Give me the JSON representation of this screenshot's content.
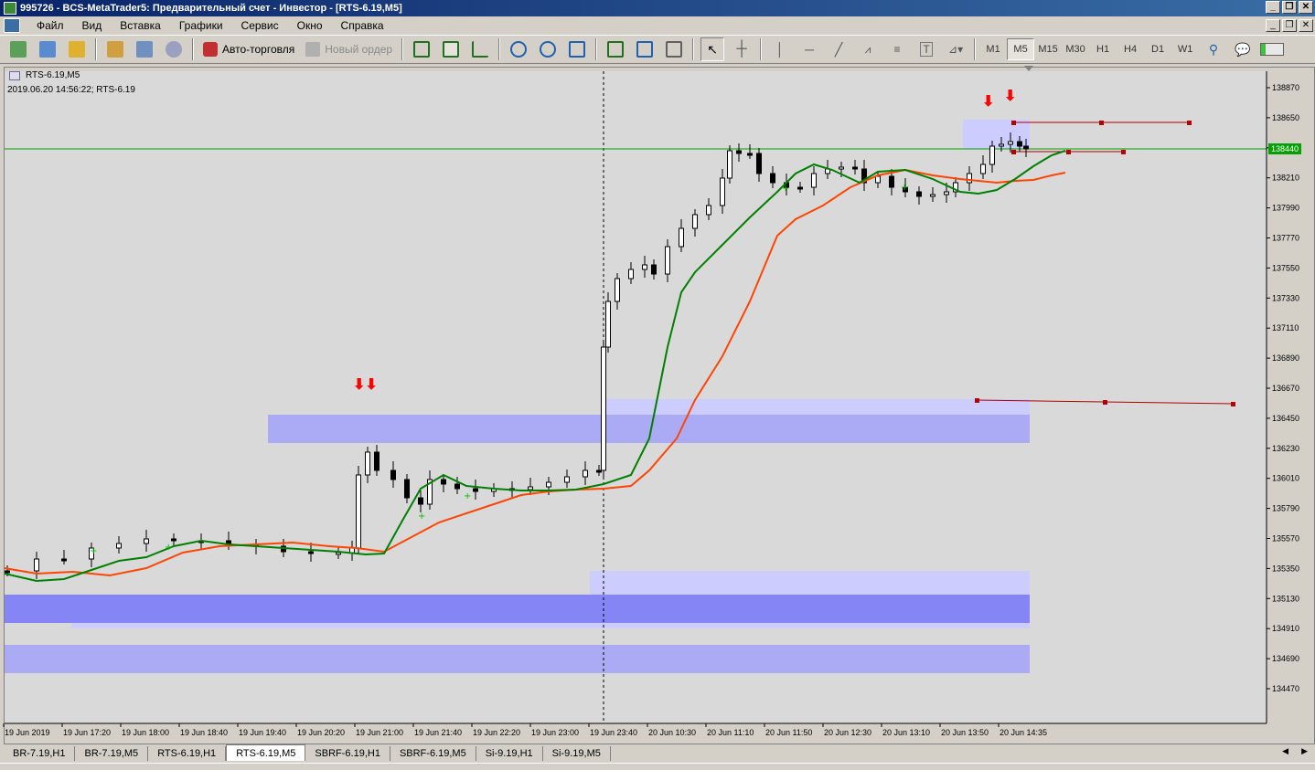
{
  "window": {
    "title": "995726 - BCS-MetaTrader5: Предварительный счет - Инвестор - [RTS-6.19,M5]"
  },
  "menu": {
    "items": [
      "Файл",
      "Вид",
      "Вставка",
      "Графики",
      "Сервис",
      "Окно",
      "Справка"
    ]
  },
  "toolbar": {
    "auto_trading_label": "Авто-торговля",
    "new_order_label": "Новый ордер",
    "timeframes": [
      "M1",
      "M5",
      "M15",
      "M30",
      "H1",
      "H4",
      "D1",
      "W1"
    ],
    "active_timeframe": "M5"
  },
  "chart": {
    "symbol_label": "RTS-6.19,M5",
    "info_line": "2019.06.20 14:56:22; RTS-6.19",
    "current_price": "138440",
    "price_ticks": [
      "138870",
      "138650",
      "138430",
      "138210",
      "137990",
      "137770",
      "137550",
      "137330",
      "137110",
      "136890",
      "136670",
      "136450",
      "136230",
      "136010",
      "135790",
      "135570",
      "135350",
      "135130",
      "134910",
      "134690",
      "134470"
    ],
    "time_ticks": [
      "19 Jun 2019",
      "19 Jun 17:20",
      "19 Jun 18:00",
      "19 Jun 18:40",
      "19 Jun 19:40",
      "19 Jun 20:20",
      "19 Jun 21:00",
      "19 Jun 21:40",
      "19 Jun 22:20",
      "19 Jun 23:00",
      "19 Jun 23:40",
      "20 Jun 10:30",
      "20 Jun 11:10",
      "20 Jun 11:50",
      "20 Jun 12:30",
      "20 Jun 13:10",
      "20 Jun 13:50",
      "20 Jun 14:35"
    ],
    "colors": {
      "background": "#d4d0c8",
      "price_line": "#00a000",
      "ma_fast": "#008000",
      "ma_slow": "#ff4500",
      "zone_light": "#ccccff",
      "zone_mid": "#aaaaf5",
      "zone_dark": "#8585f5",
      "level_line": "#b00000",
      "signal_arrow": "#ff0000"
    }
  },
  "tabs": {
    "items": [
      "BR-7.19,H1",
      "BR-7.19,M5",
      "RTS-6.19,H1",
      "RTS-6.19,M5",
      "SBRF-6.19,H1",
      "SBRF-6.19,M5",
      "Si-9.19,H1",
      "Si-9.19,M5"
    ],
    "active": "RTS-6.19,M5"
  }
}
